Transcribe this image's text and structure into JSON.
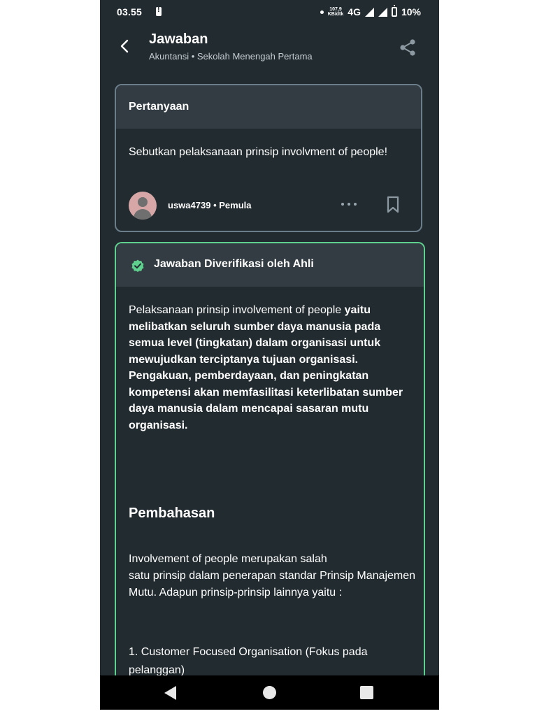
{
  "status_bar": {
    "time": "03.55",
    "speed_value": "107,9",
    "speed_unit": "KB/dtk",
    "network": "4G",
    "battery": "10%"
  },
  "header": {
    "title": "Jawaban",
    "subtitle": "Akuntansi • Sekolah Menengah Pertama"
  },
  "question": {
    "heading": "Pertanyaan",
    "text": "Sebutkan pelaksanaan prinsip involvment of people!",
    "username": "uswa4739",
    "rank": "Pemula"
  },
  "answer": {
    "heading": "Jawaban Diverifikasi oleh Ahli",
    "intro": "Pelaksanaan prinsip involvement of people",
    "bold_text": "yaitu melibatkan seluruh sumber daya manusia pada semua level (tingkatan) dalam organisasi untuk mewujudkan terciptanya tujuan organisasi. Pengakuan, pemberdayaan, dan peningkatan kompetensi akan memfasilitasi keterlibatan sumber daya manusia dalam mencapai sasaran mutu organisasi.",
    "section_title": "Pembahasan",
    "paragraph_line1": "Involvement of people merupakan salah",
    "paragraph_rest": "satu prinsip dalam penerapan standar Prinsip Manajemen Mutu. Adapun prinsip-prinsip lainnya yaitu :",
    "list_item_1": "1. Customer Focused Organisation (Fokus pada pelanggan)"
  },
  "colors": {
    "background": "#222b30",
    "card_header": "#323c42",
    "verified_accent": "#5fd18e",
    "question_border": "#6c7d8a"
  },
  "icons": {
    "back": "chevron-left-icon",
    "share": "share-icon",
    "more": "more-dots-icon",
    "bookmark": "bookmark-icon",
    "verified": "verified-check-icon"
  }
}
